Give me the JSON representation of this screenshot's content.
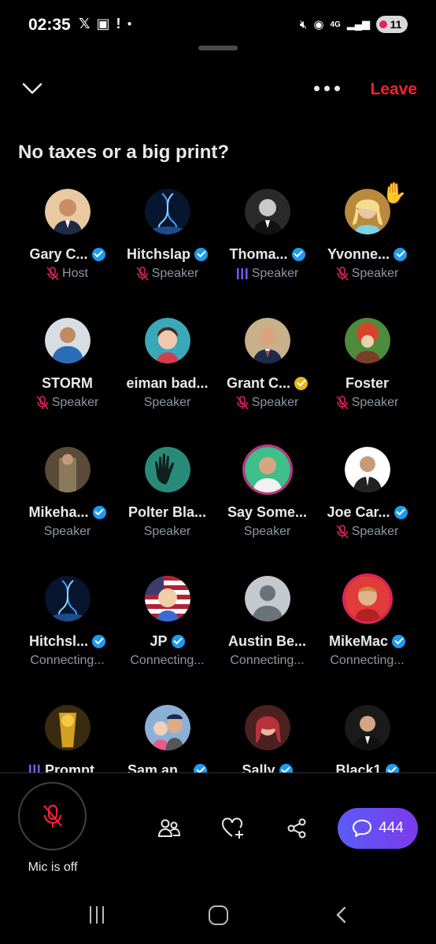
{
  "status_bar": {
    "time": "02:35",
    "battery": "11",
    "network": "4G",
    "icons_left": [
      "x-app-icon",
      "screenshot-icon",
      "alert-icon",
      "dot-icon"
    ],
    "icons_right": [
      "mute-icon",
      "hotspot-icon",
      "network-4g-icon",
      "signal-icon",
      "battery-icon"
    ]
  },
  "header": {
    "leave_label": "Leave",
    "leave_color": "#f4212e"
  },
  "space": {
    "title": "No taxes or a big print?"
  },
  "participants": [
    {
      "name": "Gary C...",
      "role": "Host",
      "verified": "blue",
      "mic": "muted",
      "avatar": "photo-gary"
    },
    {
      "name": "Hitchslap",
      "role": "Speaker",
      "verified": "blue",
      "mic": "muted",
      "avatar": "photo-dna"
    },
    {
      "name": "Thoma...",
      "role": "Speaker",
      "verified": "blue",
      "mic": "speaking",
      "avatar": "photo-thomas"
    },
    {
      "name": "Yvonne...",
      "role": "Speaker",
      "verified": "blue",
      "mic": "muted",
      "avatar": "photo-yvonne",
      "hand_raised": true
    },
    {
      "name": "STORM",
      "role": "Speaker",
      "verified": "none",
      "mic": "muted",
      "avatar": "photo-storm"
    },
    {
      "name": "eiman bad...",
      "role": "Speaker",
      "verified": "none",
      "mic": "none",
      "avatar": "photo-eiman"
    },
    {
      "name": "Grant C...",
      "role": "Speaker",
      "verified": "gold",
      "mic": "muted",
      "avatar": "photo-grant"
    },
    {
      "name": "Foster",
      "role": "Speaker",
      "verified": "none",
      "mic": "muted",
      "avatar": "photo-foster"
    },
    {
      "name": "Mikeha...",
      "role": "Speaker",
      "verified": "blue",
      "mic": "none",
      "avatar": "photo-mikeha"
    },
    {
      "name": "Polter Bla...",
      "role": "Speaker",
      "verified": "none",
      "mic": "none",
      "avatar": "photo-polter"
    },
    {
      "name": "Say Some...",
      "role": "Speaker",
      "verified": "none",
      "mic": "none",
      "avatar": "photo-saysome"
    },
    {
      "name": "Joe Car...",
      "role": "Speaker",
      "verified": "blue",
      "mic": "muted",
      "avatar": "photo-joe"
    },
    {
      "name": "Hitchsl...",
      "role": "Connecting...",
      "verified": "blue",
      "mic": "none",
      "avatar": "photo-dna"
    },
    {
      "name": "JP",
      "role": "Connecting...",
      "verified": "blue",
      "mic": "none",
      "avatar": "photo-jp"
    },
    {
      "name": "Austin Be...",
      "role": "Connecting...",
      "verified": "none",
      "mic": "none",
      "avatar": "default-avatar"
    },
    {
      "name": "MikeMac",
      "role": "Connecting...",
      "verified": "blue",
      "mic": "none",
      "avatar": "photo-mikemac"
    },
    {
      "name": "Prompt...",
      "role": "",
      "verified": "none",
      "mic": "speaking",
      "avatar": "photo-prompt"
    },
    {
      "name": "Sam an...",
      "role": "",
      "verified": "blue",
      "mic": "none",
      "avatar": "photo-sam"
    },
    {
      "name": "Sally",
      "role": "",
      "verified": "blue",
      "mic": "none",
      "avatar": "photo-sally"
    },
    {
      "name": "Black1",
      "role": "",
      "verified": "blue",
      "mic": "none",
      "avatar": "photo-black1"
    }
  ],
  "controls": {
    "mic_label": "Mic is off",
    "chat_count": "444",
    "accent": "#6a4cf5",
    "actions": [
      "people-icon",
      "heart-plus-icon",
      "share-icon"
    ]
  }
}
